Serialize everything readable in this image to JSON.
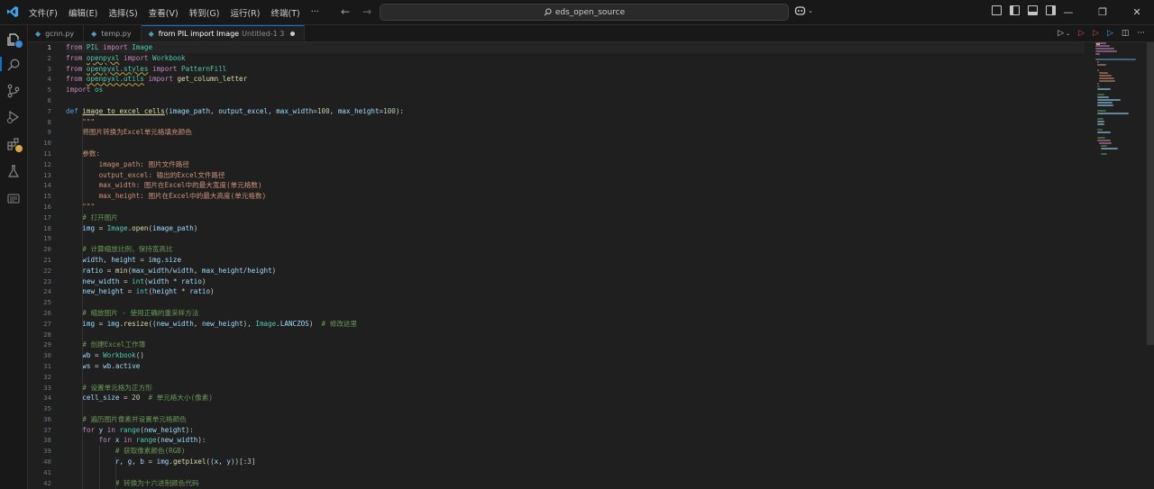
{
  "menu": [
    "文件(F)",
    "编辑(E)",
    "选择(S)",
    "查看(V)",
    "转到(G)",
    "运行(R)",
    "终端(T)",
    "···"
  ],
  "search": {
    "text": "eds_open_source"
  },
  "tabs": [
    {
      "label": "gcnn.py",
      "description": "",
      "active": false,
      "dirty": false
    },
    {
      "label": "temp.py",
      "description": "",
      "active": false,
      "dirty": false
    },
    {
      "label": "from PIL import Image",
      "description": "Untitled-1 3",
      "active": true,
      "dirty": true
    }
  ],
  "colors": {
    "keyword": "#c586c0",
    "def": "#569cd6",
    "function": "#dcdcaa",
    "class": "#4ec9b0",
    "string": "#ce9178",
    "comment": "#6a9955",
    "number": "#b5cea8",
    "variable": "#9cdcfe",
    "accent": "#0078d4",
    "badge": "#d9a93a"
  },
  "code": [
    {
      "n": "1",
      "t": [
        [
          "kw",
          "from"
        ],
        [
          "d",
          " "
        ],
        [
          "cls",
          "PIL"
        ],
        [
          "d",
          " "
        ],
        [
          "kw",
          "import"
        ],
        [
          "d",
          " "
        ],
        [
          "cls",
          "Image"
        ]
      ]
    },
    {
      "n": "2",
      "t": [
        [
          "kw",
          "from"
        ],
        [
          "d",
          " "
        ],
        [
          "mod",
          "openpyxl"
        ],
        [
          "d",
          " "
        ],
        [
          "kw",
          "import"
        ],
        [
          "d",
          " "
        ],
        [
          "cls",
          "Workbook"
        ]
      ]
    },
    {
      "n": "3",
      "t": [
        [
          "kw",
          "from"
        ],
        [
          "d",
          " "
        ],
        [
          "mod",
          "openpyxl.styles"
        ],
        [
          "d",
          " "
        ],
        [
          "kw",
          "import"
        ],
        [
          "d",
          " "
        ],
        [
          "cls",
          "PatternFill"
        ]
      ]
    },
    {
      "n": "4",
      "t": [
        [
          "kw",
          "from"
        ],
        [
          "d",
          " "
        ],
        [
          "mod",
          "openpyxl.utils"
        ],
        [
          "d",
          " "
        ],
        [
          "kw",
          "import"
        ],
        [
          "d",
          " "
        ],
        [
          "fn",
          "get_column_letter"
        ]
      ]
    },
    {
      "n": "5",
      "t": [
        [
          "kw",
          "import"
        ],
        [
          "d",
          " "
        ],
        [
          "cls",
          "os"
        ]
      ]
    },
    {
      "n": "6",
      "t": []
    },
    {
      "n": "7",
      "t": [
        [
          "def",
          "def"
        ],
        [
          "d",
          " "
        ],
        [
          "fnu",
          "image_to_excel_cells"
        ],
        [
          "d",
          "("
        ],
        [
          "var",
          "image_path"
        ],
        [
          "d",
          ", "
        ],
        [
          "var",
          "output_excel"
        ],
        [
          "d",
          ", "
        ],
        [
          "var",
          "max_width"
        ],
        [
          "d",
          "="
        ],
        [
          "num",
          "100"
        ],
        [
          "d",
          ", "
        ],
        [
          "var",
          "max_height"
        ],
        [
          "d",
          "="
        ],
        [
          "num",
          "100"
        ],
        [
          "d",
          "):"
        ]
      ]
    },
    {
      "n": "8",
      "t": [
        [
          "d",
          "    "
        ],
        [
          "str",
          "\"\"\""
        ]
      ]
    },
    {
      "n": "9",
      "t": [
        [
          "d",
          "    "
        ],
        [
          "str",
          "将图片转换为Excel单元格填充颜色"
        ]
      ]
    },
    {
      "n": "10",
      "t": []
    },
    {
      "n": "11",
      "t": [
        [
          "d",
          "    "
        ],
        [
          "str",
          "参数:"
        ]
      ]
    },
    {
      "n": "12",
      "t": [
        [
          "d",
          "        "
        ],
        [
          "str",
          "image_path: 图片文件路径"
        ]
      ]
    },
    {
      "n": "13",
      "t": [
        [
          "d",
          "        "
        ],
        [
          "str",
          "output_excel: 输出的Excel文件路径"
        ]
      ]
    },
    {
      "n": "14",
      "t": [
        [
          "d",
          "        "
        ],
        [
          "str",
          "max_width: 图片在Excel中的最大宽度(单元格数)"
        ]
      ]
    },
    {
      "n": "15",
      "t": [
        [
          "d",
          "        "
        ],
        [
          "str",
          "max_height: 图片在Excel中的最大高度(单元格数)"
        ]
      ]
    },
    {
      "n": "16",
      "t": [
        [
          "d",
          "    "
        ],
        [
          "str",
          "\"\"\""
        ]
      ]
    },
    {
      "n": "17",
      "t": [
        [
          "d",
          "    "
        ],
        [
          "cm",
          "# 打开图片"
        ]
      ]
    },
    {
      "n": "18",
      "t": [
        [
          "d",
          "    "
        ],
        [
          "var",
          "img"
        ],
        [
          "d",
          " = "
        ],
        [
          "cls",
          "Image"
        ],
        [
          "d",
          "."
        ],
        [
          "fn",
          "open"
        ],
        [
          "d",
          "("
        ],
        [
          "var",
          "image_path"
        ],
        [
          "d",
          ")"
        ]
      ]
    },
    {
      "n": "19",
      "t": []
    },
    {
      "n": "20",
      "t": [
        [
          "d",
          "    "
        ],
        [
          "cm",
          "# 计算缩放比例，保持宽高比"
        ]
      ]
    },
    {
      "n": "21",
      "t": [
        [
          "d",
          "    "
        ],
        [
          "var",
          "width"
        ],
        [
          "d",
          ", "
        ],
        [
          "var",
          "height"
        ],
        [
          "d",
          " = "
        ],
        [
          "var",
          "img"
        ],
        [
          "d",
          "."
        ],
        [
          "var",
          "size"
        ]
      ]
    },
    {
      "n": "22",
      "t": [
        [
          "d",
          "    "
        ],
        [
          "var",
          "ratio"
        ],
        [
          "d",
          " = "
        ],
        [
          "fn",
          "min"
        ],
        [
          "d",
          "("
        ],
        [
          "var",
          "max_width"
        ],
        [
          "d",
          "/"
        ],
        [
          "var",
          "width"
        ],
        [
          "d",
          ", "
        ],
        [
          "var",
          "max_height"
        ],
        [
          "d",
          "/"
        ],
        [
          "var",
          "height"
        ],
        [
          "d",
          ")"
        ]
      ]
    },
    {
      "n": "23",
      "t": [
        [
          "d",
          "    "
        ],
        [
          "var",
          "new_width"
        ],
        [
          "d",
          " = "
        ],
        [
          "cls",
          "int"
        ],
        [
          "d",
          "("
        ],
        [
          "var",
          "width"
        ],
        [
          "d",
          " * "
        ],
        [
          "var",
          "ratio"
        ],
        [
          "d",
          ")"
        ]
      ]
    },
    {
      "n": "24",
      "t": [
        [
          "d",
          "    "
        ],
        [
          "var",
          "new_height"
        ],
        [
          "d",
          " = "
        ],
        [
          "cls",
          "int"
        ],
        [
          "d",
          "("
        ],
        [
          "var",
          "height"
        ],
        [
          "d",
          " * "
        ],
        [
          "var",
          "ratio"
        ],
        [
          "d",
          ")"
        ]
      ]
    },
    {
      "n": "25",
      "t": []
    },
    {
      "n": "26",
      "t": [
        [
          "d",
          "    "
        ],
        [
          "cm",
          "# 缩放图片 - 使用正确的重采样方法"
        ]
      ]
    },
    {
      "n": "27",
      "t": [
        [
          "d",
          "    "
        ],
        [
          "var",
          "img"
        ],
        [
          "d",
          " = "
        ],
        [
          "var",
          "img"
        ],
        [
          "d",
          "."
        ],
        [
          "fn",
          "resize"
        ],
        [
          "d",
          "(("
        ],
        [
          "var",
          "new_width"
        ],
        [
          "d",
          ", "
        ],
        [
          "var",
          "new_height"
        ],
        [
          "d",
          "), "
        ],
        [
          "cls",
          "Image"
        ],
        [
          "d",
          "."
        ],
        [
          "var",
          "LANCZOS"
        ],
        [
          "d",
          ")  "
        ],
        [
          "cm",
          "# 修改这里"
        ]
      ]
    },
    {
      "n": "28",
      "t": []
    },
    {
      "n": "29",
      "t": [
        [
          "d",
          "    "
        ],
        [
          "cm",
          "# 创建Excel工作簿"
        ]
      ]
    },
    {
      "n": "30",
      "t": [
        [
          "d",
          "    "
        ],
        [
          "var",
          "wb"
        ],
        [
          "d",
          " = "
        ],
        [
          "cls",
          "Workbook"
        ],
        [
          "d",
          "()"
        ]
      ]
    },
    {
      "n": "31",
      "t": [
        [
          "d",
          "    "
        ],
        [
          "var",
          "ws"
        ],
        [
          "d",
          " = "
        ],
        [
          "var",
          "wb"
        ],
        [
          "d",
          "."
        ],
        [
          "var",
          "active"
        ]
      ]
    },
    {
      "n": "32",
      "t": []
    },
    {
      "n": "33",
      "t": [
        [
          "d",
          "    "
        ],
        [
          "cm",
          "# 设置单元格为正方形"
        ]
      ]
    },
    {
      "n": "34",
      "t": [
        [
          "d",
          "    "
        ],
        [
          "var",
          "cell_size"
        ],
        [
          "d",
          " = "
        ],
        [
          "num",
          "20"
        ],
        [
          "d",
          "  "
        ],
        [
          "cm",
          "# 单元格大小(像素)"
        ]
      ]
    },
    {
      "n": "35",
      "t": []
    },
    {
      "n": "36",
      "t": [
        [
          "d",
          "    "
        ],
        [
          "cm",
          "# 遍历图片像素并设置单元格颜色"
        ]
      ]
    },
    {
      "n": "37",
      "t": [
        [
          "d",
          "    "
        ],
        [
          "kw",
          "for"
        ],
        [
          "d",
          " "
        ],
        [
          "var",
          "y"
        ],
        [
          "d",
          " "
        ],
        [
          "kw",
          "in"
        ],
        [
          "d",
          " "
        ],
        [
          "cls",
          "range"
        ],
        [
          "d",
          "("
        ],
        [
          "var",
          "new_height"
        ],
        [
          "d",
          "):"
        ]
      ]
    },
    {
      "n": "38",
      "t": [
        [
          "d",
          "        "
        ],
        [
          "kw",
          "for"
        ],
        [
          "d",
          " "
        ],
        [
          "var",
          "x"
        ],
        [
          "d",
          " "
        ],
        [
          "kw",
          "in"
        ],
        [
          "d",
          " "
        ],
        [
          "cls",
          "range"
        ],
        [
          "d",
          "("
        ],
        [
          "var",
          "new_width"
        ],
        [
          "d",
          "):"
        ]
      ]
    },
    {
      "n": "39",
      "t": [
        [
          "d",
          "            "
        ],
        [
          "cm",
          "# 获取像素颜色(RGB)"
        ]
      ]
    },
    {
      "n": "40",
      "t": [
        [
          "d",
          "            "
        ],
        [
          "var",
          "r"
        ],
        [
          "d",
          ", "
        ],
        [
          "var",
          "g"
        ],
        [
          "d",
          ", "
        ],
        [
          "var",
          "b"
        ],
        [
          "d",
          " = "
        ],
        [
          "var",
          "img"
        ],
        [
          "d",
          "."
        ],
        [
          "fn",
          "getpixel"
        ],
        [
          "d",
          "(("
        ],
        [
          "var",
          "x"
        ],
        [
          "d",
          ", "
        ],
        [
          "var",
          "y"
        ],
        [
          "d",
          "))[:"
        ],
        [
          "num",
          "3"
        ],
        [
          "d",
          "]"
        ]
      ]
    },
    {
      "n": "41",
      "t": []
    },
    {
      "n": "42",
      "t": [
        [
          "d",
          "            "
        ],
        [
          "cm",
          "# 转换为十六进制颜色代码"
        ]
      ]
    }
  ]
}
